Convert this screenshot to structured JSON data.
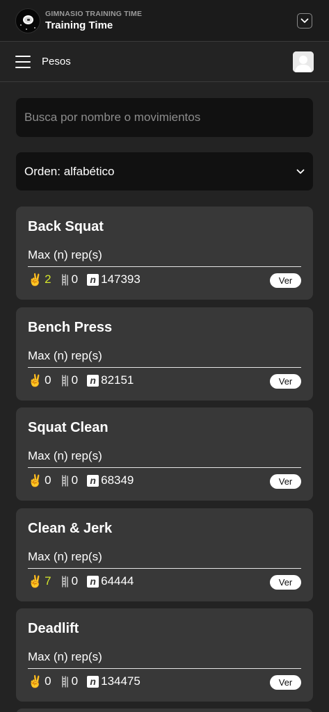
{
  "app": {
    "gym_name": "GIMNASIO TRAINING TIME",
    "title": "Training Time"
  },
  "nav": {
    "title": "Pesos"
  },
  "search": {
    "placeholder": "Busca por nombre o movimientos",
    "value": ""
  },
  "sort": {
    "label": "Orden: alfabético"
  },
  "colors": {
    "highlight": "#d4e62b",
    "card_bg": "#383838",
    "page_bg": "#232323"
  },
  "cards": [
    {
      "name": "Back Squat",
      "subtitle": "Max (n) rep(s)",
      "peace": "2",
      "peace_highlight": true,
      "ruler": "0",
      "n": "147393",
      "button": "Ver"
    },
    {
      "name": "Bench Press",
      "subtitle": "Max (n) rep(s)",
      "peace": "0",
      "peace_highlight": false,
      "ruler": "0",
      "n": "82151",
      "button": "Ver"
    },
    {
      "name": "Squat Clean",
      "subtitle": "Max (n) rep(s)",
      "peace": "0",
      "peace_highlight": false,
      "ruler": "0",
      "n": "68349",
      "button": "Ver"
    },
    {
      "name": "Clean & Jerk",
      "subtitle": "Max (n) rep(s)",
      "peace": "7",
      "peace_highlight": true,
      "ruler": "0",
      "n": "64444",
      "button": "Ver"
    },
    {
      "name": "Deadlift",
      "subtitle": "Max (n) rep(s)",
      "peace": "0",
      "peace_highlight": false,
      "ruler": "0",
      "n": "134475",
      "button": "Ver"
    }
  ],
  "icons": {
    "peace": "victory-hand-icon",
    "ruler": "ruler-icon",
    "n_badge": "n-badge-icon",
    "menu": "hamburger-icon",
    "avatar": "user-avatar-icon",
    "dropdown": "chevron-down-icon"
  }
}
